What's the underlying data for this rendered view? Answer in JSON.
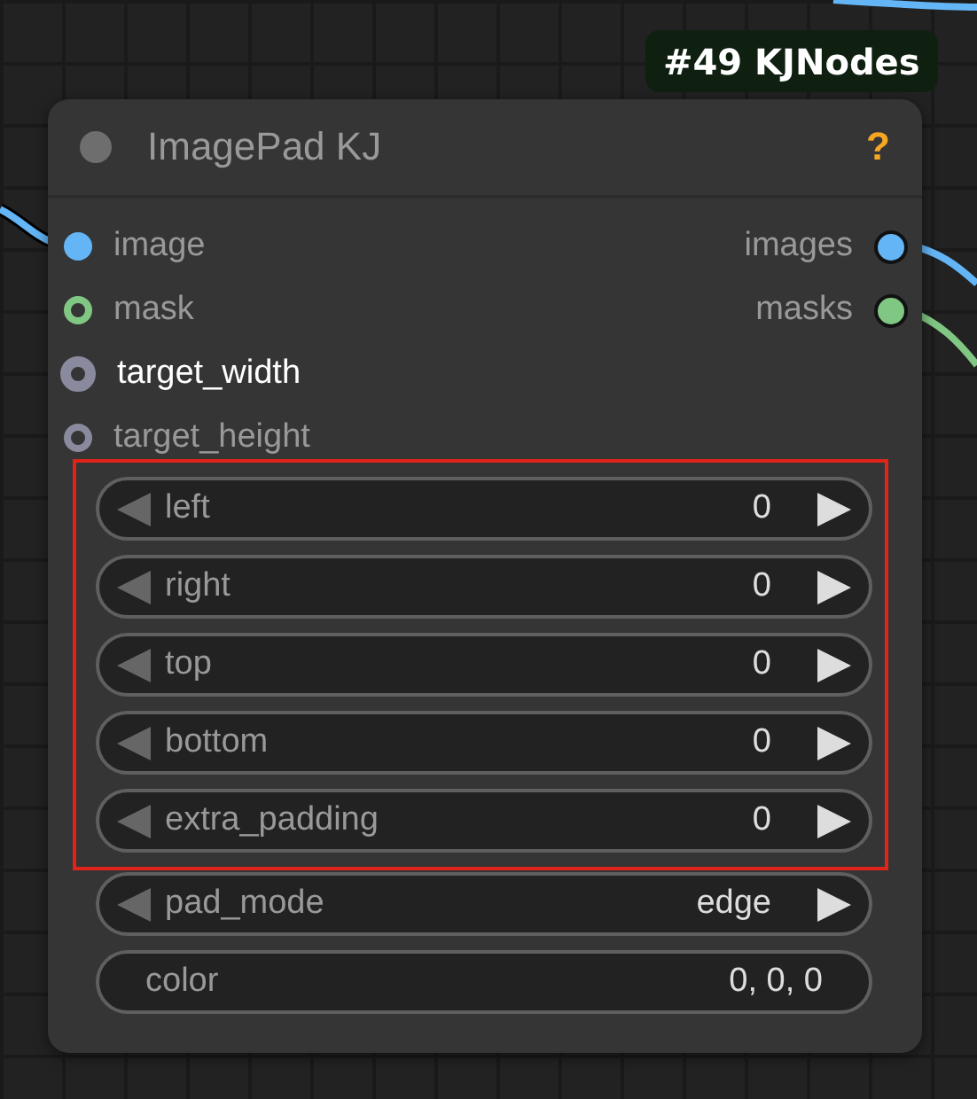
{
  "badge": "#49 KJNodes",
  "node": {
    "title": "ImagePad KJ",
    "help": "?",
    "inputs": [
      {
        "label": "image",
        "kind": "filled",
        "color": "#64b5f6",
        "highlighted": false
      },
      {
        "label": "mask",
        "kind": "ring",
        "color": "#81c784",
        "highlighted": false
      },
      {
        "label": "target_width",
        "kind": "ring",
        "color": "#8a8a9e",
        "highlighted": true
      },
      {
        "label": "target_height",
        "kind": "ring",
        "color": "#8a8a9e",
        "highlighted": false
      }
    ],
    "outputs": [
      {
        "label": "images",
        "color": "#64b5f6"
      },
      {
        "label": "masks",
        "color": "#81c784"
      }
    ],
    "widget_groups": [
      {
        "highlighted": true,
        "widgets": [
          {
            "kind": "number",
            "label": "left",
            "value": "0"
          },
          {
            "kind": "number",
            "label": "right",
            "value": "0"
          },
          {
            "kind": "number",
            "label": "top",
            "value": "0"
          },
          {
            "kind": "number",
            "label": "bottom",
            "value": "0"
          },
          {
            "kind": "number",
            "label": "extra_padding",
            "value": "0"
          }
        ]
      },
      {
        "highlighted": false,
        "widgets": [
          {
            "kind": "combo",
            "label": "pad_mode",
            "value": "edge"
          },
          {
            "kind": "text",
            "label": "color",
            "value": "0, 0, 0"
          }
        ]
      }
    ]
  }
}
